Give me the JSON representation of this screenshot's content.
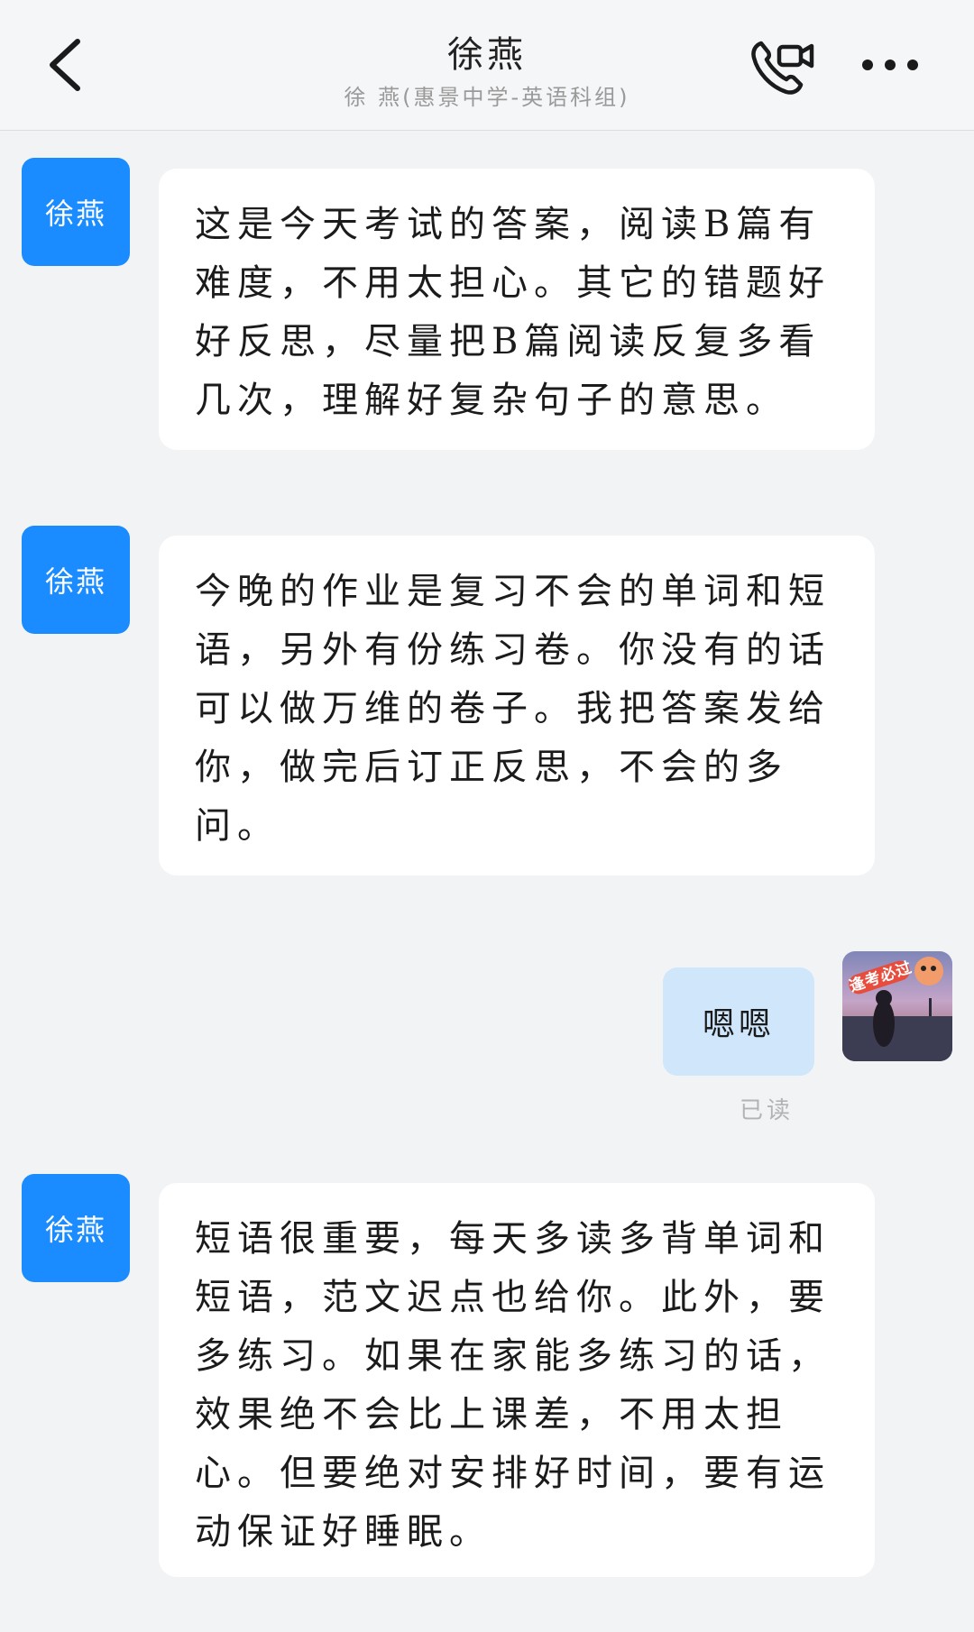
{
  "header": {
    "title": "徐燕",
    "subtitle": "徐 燕(惠景中学-英语科组)"
  },
  "messages": [
    {
      "sender": "teacher",
      "avatar_text": "徐燕",
      "text": "这是今天考试的答案，阅读B篇有难度，不用太担心。其它的错题好好反思，尽量把B篇阅读反复多看几次，理解好复杂句子的意思。"
    },
    {
      "sender": "teacher",
      "avatar_text": "徐燕",
      "text": "今晚的作业是复习不会的单词和短语，另外有份练习卷。你没有的话可以做万维的卷子。我把答案发给你，做完后订正反思，不会的多问。"
    },
    {
      "sender": "me",
      "text": "嗯嗯",
      "status": "已读",
      "avatar_badge": "逢考必过"
    },
    {
      "sender": "teacher",
      "avatar_text": "徐燕",
      "text": "短语很重要，每天多读多背单词和短语，范文迟点也给你。此外，要多练习。如果在家能多练习的话，效果绝不会比上课差，不用太担心。但要绝对安排好时间，要有运动保证好睡眠。"
    }
  ],
  "colors": {
    "teacher_avatar_bg": "#1a8cff",
    "outgoing_bubble_bg": "#cfe6fb",
    "incoming_bubble_bg": "#ffffff",
    "chat_bg": "#f2f3f5"
  },
  "icons": {
    "back": "chevron-left-icon",
    "call": "phone-video-icon",
    "more": "more-dots-icon"
  }
}
